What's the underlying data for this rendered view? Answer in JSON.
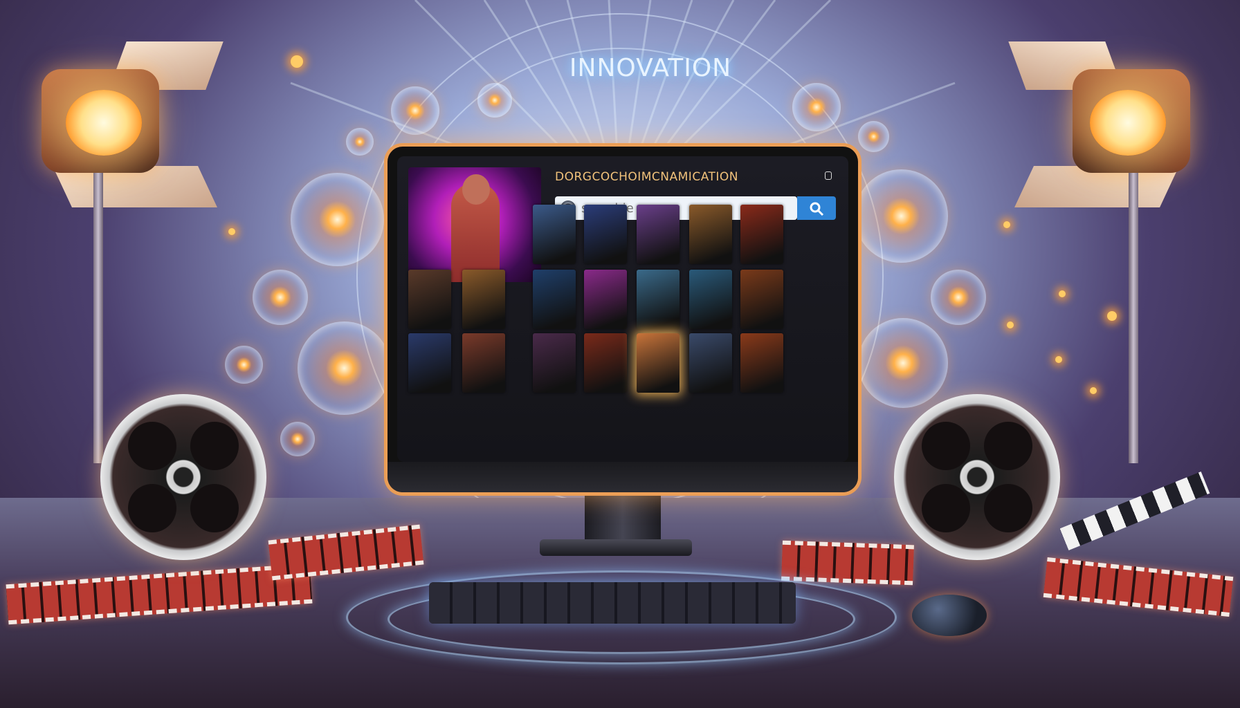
{
  "headline": "INNOVATION",
  "app": {
    "title": "DORGCOCHOIMCNAMICATION",
    "search": {
      "placeholder": "searchie",
      "value": "",
      "button_icon": "search-icon"
    },
    "featured_poster": "featured-movie-poster",
    "poster_rows": [
      [
        "#3b5a8a",
        "#2b3d7a",
        "#6a3f8a",
        "#8a5a2a",
        "#8a2a1a"
      ],
      [
        "#1f3f6a",
        "#8a2a8a",
        "#3a6a8a",
        "#2a5a7a",
        "#7a3a1a"
      ],
      [
        "#4a2a4a",
        "#7a2a1a",
        "#c8743a",
        "#3a4a6a",
        "#8a3a1a"
      ]
    ],
    "left_posters": [
      [
        "#5a3a2a",
        "#8a5a2a"
      ],
      [
        "#2a3a6a",
        "#7a3a2a"
      ]
    ]
  },
  "colors": {
    "accent_glow": "#ff9b2e",
    "search_button": "#2f84d6",
    "title_text": "#f1c27b"
  }
}
